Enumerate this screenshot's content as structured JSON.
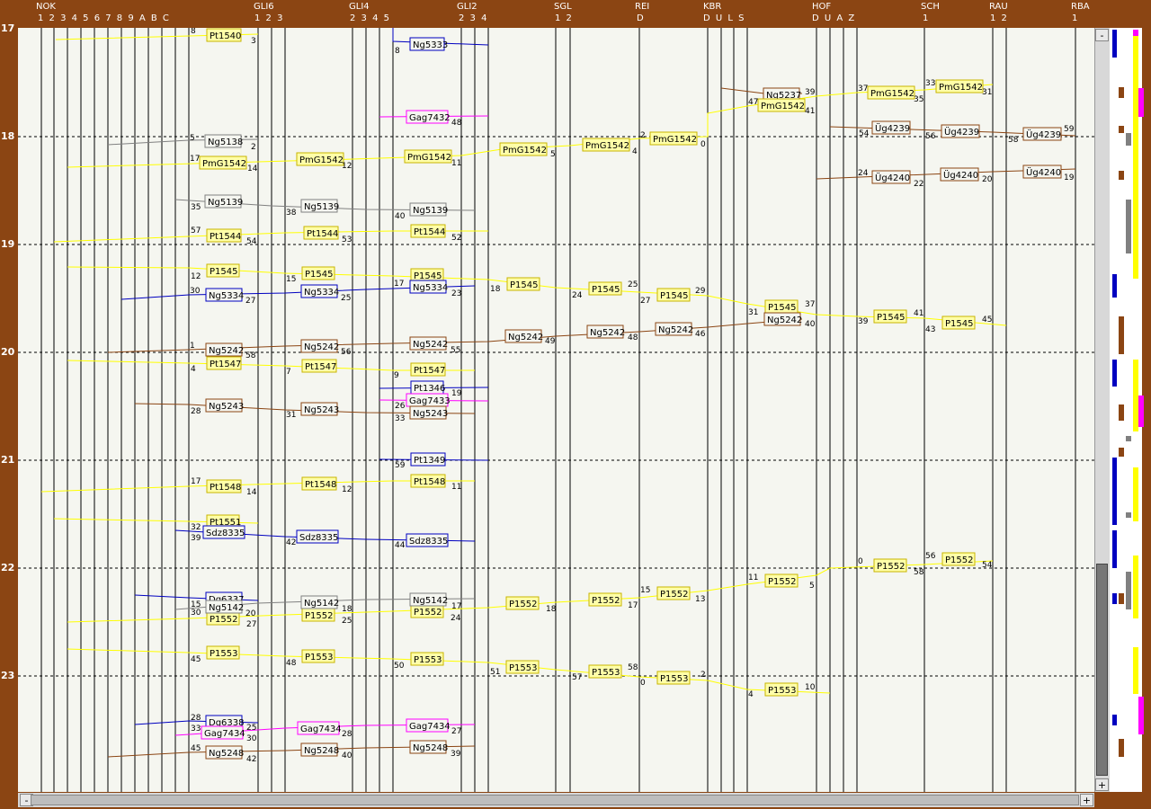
{
  "stations": [
    {
      "id": "nok",
      "name": "NOK",
      "tracks": "1 2 3 4 5 6 7 8 9 A B C"
    },
    {
      "id": "gli6",
      "name": "GLI6",
      "tracks": "1 2 3"
    },
    {
      "id": "gli4",
      "name": "GLI4",
      "tracks": "2 3 4 5"
    },
    {
      "id": "gli2",
      "name": "GLI2",
      "tracks": "2 3 4"
    },
    {
      "id": "sgl",
      "name": "SGL",
      "tracks": "1 2"
    },
    {
      "id": "rei",
      "name": "REI",
      "tracks": "D"
    },
    {
      "id": "kbr",
      "name": "KBR",
      "tracks": "D U L S"
    },
    {
      "id": "hof",
      "name": "HOF",
      "tracks": "D U A Z"
    },
    {
      "id": "sch",
      "name": "SCH",
      "tracks": "1"
    },
    {
      "id": "rau",
      "name": "RAU",
      "tracks": "1 2"
    },
    {
      "id": "rba",
      "name": "RBA",
      "tracks": "1"
    }
  ],
  "hours": [
    "17",
    "18",
    "19",
    "20",
    "21",
    "22",
    "23"
  ],
  "colors": {
    "background": "#8b4513",
    "graph": "#f5f6f0",
    "Pt": "#ffff00",
    "P": "#ffff00",
    "PmG": "#ffff00",
    "Ng": "#808080",
    "NgBlue": "#0000c0",
    "NgBrown": "#8b4513",
    "Gag": "#ff00ff",
    "Ug": "#8b4513",
    "Sdz": "#0000c0",
    "Dg": "#0000c0"
  },
  "trains": [
    {
      "id": "Pt1540",
      "color": "#ffff00",
      "border": "#000",
      "label": "Pt1540",
      "nums": [
        "8",
        "3"
      ]
    },
    {
      "id": "Ng5333",
      "color": "#0000c0",
      "border": "#0000c0",
      "label": "Ng5333",
      "nums": [
        "8"
      ]
    },
    {
      "id": "Gag7432",
      "color": "#ff00ff",
      "border": "#ff00ff",
      "label": "Gag7432",
      "nums": [
        "48"
      ]
    },
    {
      "id": "Ng5237",
      "color": "#8b4513",
      "border": "#8b4513",
      "label": "Ng5237",
      "nums": [
        "39"
      ]
    },
    {
      "id": "PmG1542",
      "color": "#ffff00",
      "border": "#000",
      "label": "PmG1542",
      "nums": [
        "17",
        "14",
        "12",
        "11",
        "5",
        "4",
        "2",
        "0",
        "47",
        "41",
        "37",
        "35",
        "33",
        "31"
      ]
    },
    {
      "id": "Ng5138",
      "color": "#808080",
      "border": "#808080",
      "label": "Ng5138",
      "nums": [
        "5",
        "2"
      ]
    },
    {
      "id": "Ug4239",
      "color": "#8b4513",
      "border": "#8b4513",
      "label": "Üg4239",
      "nums": [
        "54",
        "56",
        "58",
        "59"
      ]
    },
    {
      "id": "Ug4240",
      "color": "#8b4513",
      "border": "#8b4513",
      "label": "Üg4240",
      "nums": [
        "24",
        "22",
        "20",
        "19"
      ]
    },
    {
      "id": "Ng5139",
      "color": "#808080",
      "border": "#808080",
      "label": "Ng5139",
      "nums": [
        "35",
        "38",
        "40"
      ]
    },
    {
      "id": "Pt1544",
      "color": "#ffff00",
      "border": "#000",
      "label": "Pt1544",
      "nums": [
        "57",
        "54",
        "53",
        "52"
      ]
    },
    {
      "id": "P1545",
      "color": "#ffff00",
      "border": "#000",
      "label": "P1545",
      "nums": [
        "12",
        "15",
        "17",
        "18",
        "24",
        "25",
        "27",
        "29",
        "31",
        "37",
        "39",
        "41",
        "43",
        "45"
      ]
    },
    {
      "id": "Ng5334",
      "color": "#0000c0",
      "border": "#0000c0",
      "label": "Ng5334",
      "nums": [
        "30",
        "27",
        "25",
        "23"
      ]
    },
    {
      "id": "Ng5242",
      "color": "#8b4513",
      "border": "#8b4513",
      "label": "Ng5242",
      "nums": [
        "1",
        "58",
        "56",
        "55",
        "49",
        "48",
        "46",
        "40"
      ]
    },
    {
      "id": "Pt1547",
      "color": "#ffff00",
      "border": "#000",
      "label": "Pt1547",
      "nums": [
        "4",
        "7",
        "9"
      ]
    },
    {
      "id": "Pt1346",
      "color": "#0000c0",
      "border": "#0000c0",
      "label": "Pt1346",
      "nums": [
        "19"
      ]
    },
    {
      "id": "Gag7433",
      "color": "#ff00ff",
      "border": "#ff00ff",
      "label": "Gag7433",
      "nums": [
        "26"
      ]
    },
    {
      "id": "Ng5243",
      "color": "#8b4513",
      "border": "#8b4513",
      "label": "Ng5243",
      "nums": [
        "28",
        "31",
        "33"
      ]
    },
    {
      "id": "Pt1349",
      "color": "#0000c0",
      "border": "#0000c0",
      "label": "Pt1349",
      "nums": [
        "59"
      ]
    },
    {
      "id": "Pt1548",
      "color": "#ffff00",
      "border": "#000",
      "label": "Pt1548",
      "nums": [
        "17",
        "14",
        "12",
        "11"
      ]
    },
    {
      "id": "Pt1551",
      "color": "#ffff00",
      "border": "#000",
      "label": "Pt1551",
      "nums": [
        "32"
      ]
    },
    {
      "id": "Sdz8335",
      "color": "#0000c0",
      "border": "#0000c0",
      "label": "Sdz8335",
      "nums": [
        "39",
        "42",
        "44"
      ]
    },
    {
      "id": "P1552",
      "color": "#ffff00",
      "border": "#000",
      "label": "P1552",
      "nums": [
        "0",
        "58",
        "56",
        "54",
        "11",
        "5",
        "15",
        "13",
        "17",
        "18",
        "24",
        "25",
        "27",
        "30"
      ]
    },
    {
      "id": "Dg6337",
      "color": "#0000c0",
      "border": "#0000c0",
      "label": "Dg6337",
      "nums": [
        "15"
      ]
    },
    {
      "id": "Ng5142",
      "color": "#808080",
      "border": "#808080",
      "label": "Ng5142",
      "nums": [
        "20",
        "18",
        "17"
      ]
    },
    {
      "id": "P1553",
      "color": "#ffff00",
      "border": "#000",
      "label": "P1553",
      "nums": [
        "45",
        "48",
        "50",
        "51",
        "57",
        "58",
        "0",
        "2",
        "4",
        "10"
      ]
    },
    {
      "id": "Dg6338",
      "color": "#0000c0",
      "border": "#0000c0",
      "label": "Dg6338",
      "nums": [
        "28",
        "25"
      ]
    },
    {
      "id": "Gag7434",
      "color": "#ff00ff",
      "border": "#ff00ff",
      "label": "Gag7434",
      "nums": [
        "33",
        "30",
        "28",
        "27"
      ]
    },
    {
      "id": "Ng5248",
      "color": "#8b4513",
      "border": "#8b4513",
      "label": "Ng5248",
      "nums": [
        "45",
        "42",
        "40",
        "39"
      ]
    }
  ],
  "scroll": {
    "up": "-",
    "down": "+",
    "left": "-",
    "right": "+"
  }
}
